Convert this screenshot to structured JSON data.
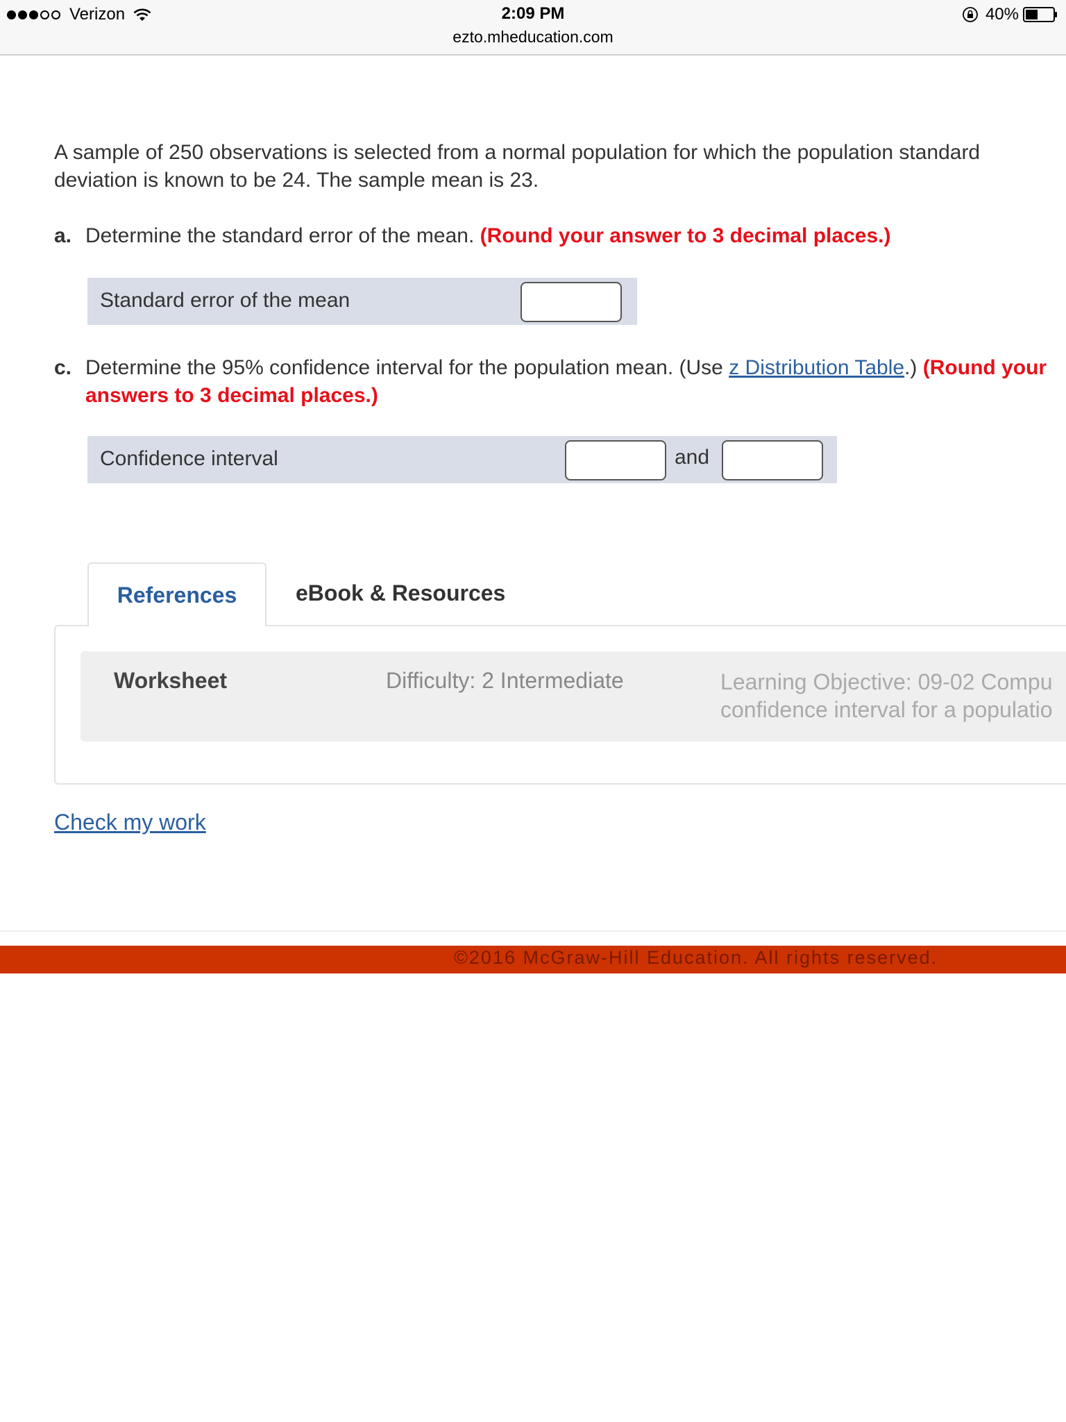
{
  "status_bar": {
    "carrier": "Verizon",
    "time": "2:09 PM",
    "url": "ezto.mheducation.com",
    "battery": "40%",
    "signal_strength": 3,
    "signal_max": 5
  },
  "question": {
    "prompt": "A sample of 250 observations is selected from a normal population for which the population standard deviation is known to be 24. The sample mean is 23.",
    "part_a": {
      "letter": "a.",
      "text": "Determine the standard error of the mean.",
      "instruction": "(Round your answer to 3 decimal places.)",
      "row_label": "Standard error of the mean",
      "value": ""
    },
    "part_c": {
      "letter": "c.",
      "text_before": "Determine the 95% confidence interval for the population mean. (Use ",
      "link": "z Distribution Table",
      "text_after": ".)",
      "instruction": "(Round your answers to 3 decimal places.)",
      "row_label": "Confidence interval",
      "joiner": "and",
      "lower_value": "",
      "upper_value": ""
    }
  },
  "tabs": [
    {
      "label": "References",
      "active": true
    },
    {
      "label": "eBook & Resources",
      "active": false
    }
  ],
  "references": {
    "worksheet": "Worksheet",
    "difficulty": "Difficulty: 2 Intermediate",
    "objective_line1": "Learning Objective: 09-02 Compu",
    "objective_line2": "confidence interval for a populatio"
  },
  "check_my_work": "Check my work",
  "footer": {
    "copyright": "©2016 McGraw-Hill Education. All rights reserved.",
    "bar_color": "#cc3300"
  },
  "colors": {
    "accent_link": "#2a5fa0",
    "instruction_red": "#e8101a",
    "answer_row_bg": "#d9dde8"
  }
}
